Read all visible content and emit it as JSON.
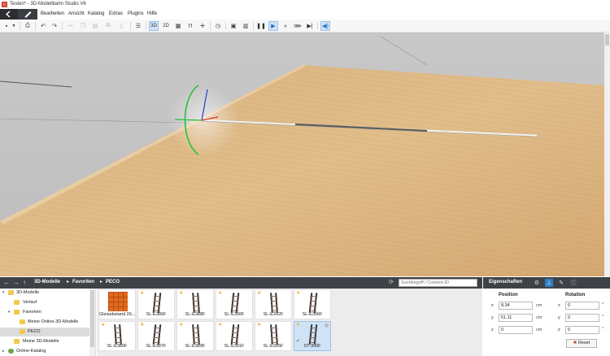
{
  "window": {
    "title": "Testen* - 3D-Modellbahn Studio V6"
  },
  "menu": [
    "Bearbeiten",
    "Ansicht",
    "Katalog",
    "Extras",
    "Plugins",
    "Hilfe"
  ],
  "toolbar": {
    "btn_3d": "3D",
    "btn_2d": "2D"
  },
  "catalog": {
    "breadcrumb": [
      "3D-Modelle",
      "Favoriten",
      "PECO"
    ],
    "search_placeholder": "Suchbegriff / Content-ID"
  },
  "tree": [
    {
      "label": "3D-Modelle",
      "level": 0,
      "expanded": true
    },
    {
      "label": "Verlauf",
      "level": 1,
      "expanded": false
    },
    {
      "label": "Favoriten",
      "level": 1,
      "expanded": true
    },
    {
      "label": "Meine Online-3D-Modelle",
      "level": 2,
      "expanded": false
    },
    {
      "label": "PECO",
      "level": 2,
      "expanded": false,
      "selected": true
    },
    {
      "label": "Meine 3D-Modelle",
      "level": 1,
      "expanded": false
    },
    {
      "label": "Online-Katalog",
      "level": 0,
      "expanded": false
    }
  ],
  "gallery": [
    {
      "label": "Gleisabstand 26....",
      "fav": false,
      "kind": "grid"
    },
    {
      "label": "SL-E386F",
      "fav": true
    },
    {
      "label": "SL-E388F",
      "fav": true
    },
    {
      "label": "SL-E390F",
      "fav": true
    },
    {
      "label": "SL-E392F",
      "fav": true
    },
    {
      "label": "SL-E396F",
      "fav": true
    },
    {
      "label": "SL-E380F",
      "fav": true
    },
    {
      "label": "SL-E387F",
      "fav": true
    },
    {
      "label": "SL-E389F",
      "fav": true
    },
    {
      "label": "SL-E391F",
      "fav": true
    },
    {
      "label": "SL-E395F",
      "fav": true
    },
    {
      "label": "ST-300F",
      "fav": true,
      "selected": true
    }
  ],
  "properties": {
    "title": "Eigenschaften",
    "position_label": "Position",
    "rotation_label": "Rotation",
    "axes": [
      "x",
      "y",
      "z"
    ],
    "position": [
      "8,34",
      "51,11",
      "0"
    ],
    "rotation": [
      "0",
      "0",
      "0"
    ],
    "unit": "cm",
    "deg_unit": "°",
    "reset_label": "Reset"
  },
  "colors": {
    "accent": "#2f7ec9",
    "panel_dark": "#3e4146",
    "selection": "#cfe3f7"
  }
}
